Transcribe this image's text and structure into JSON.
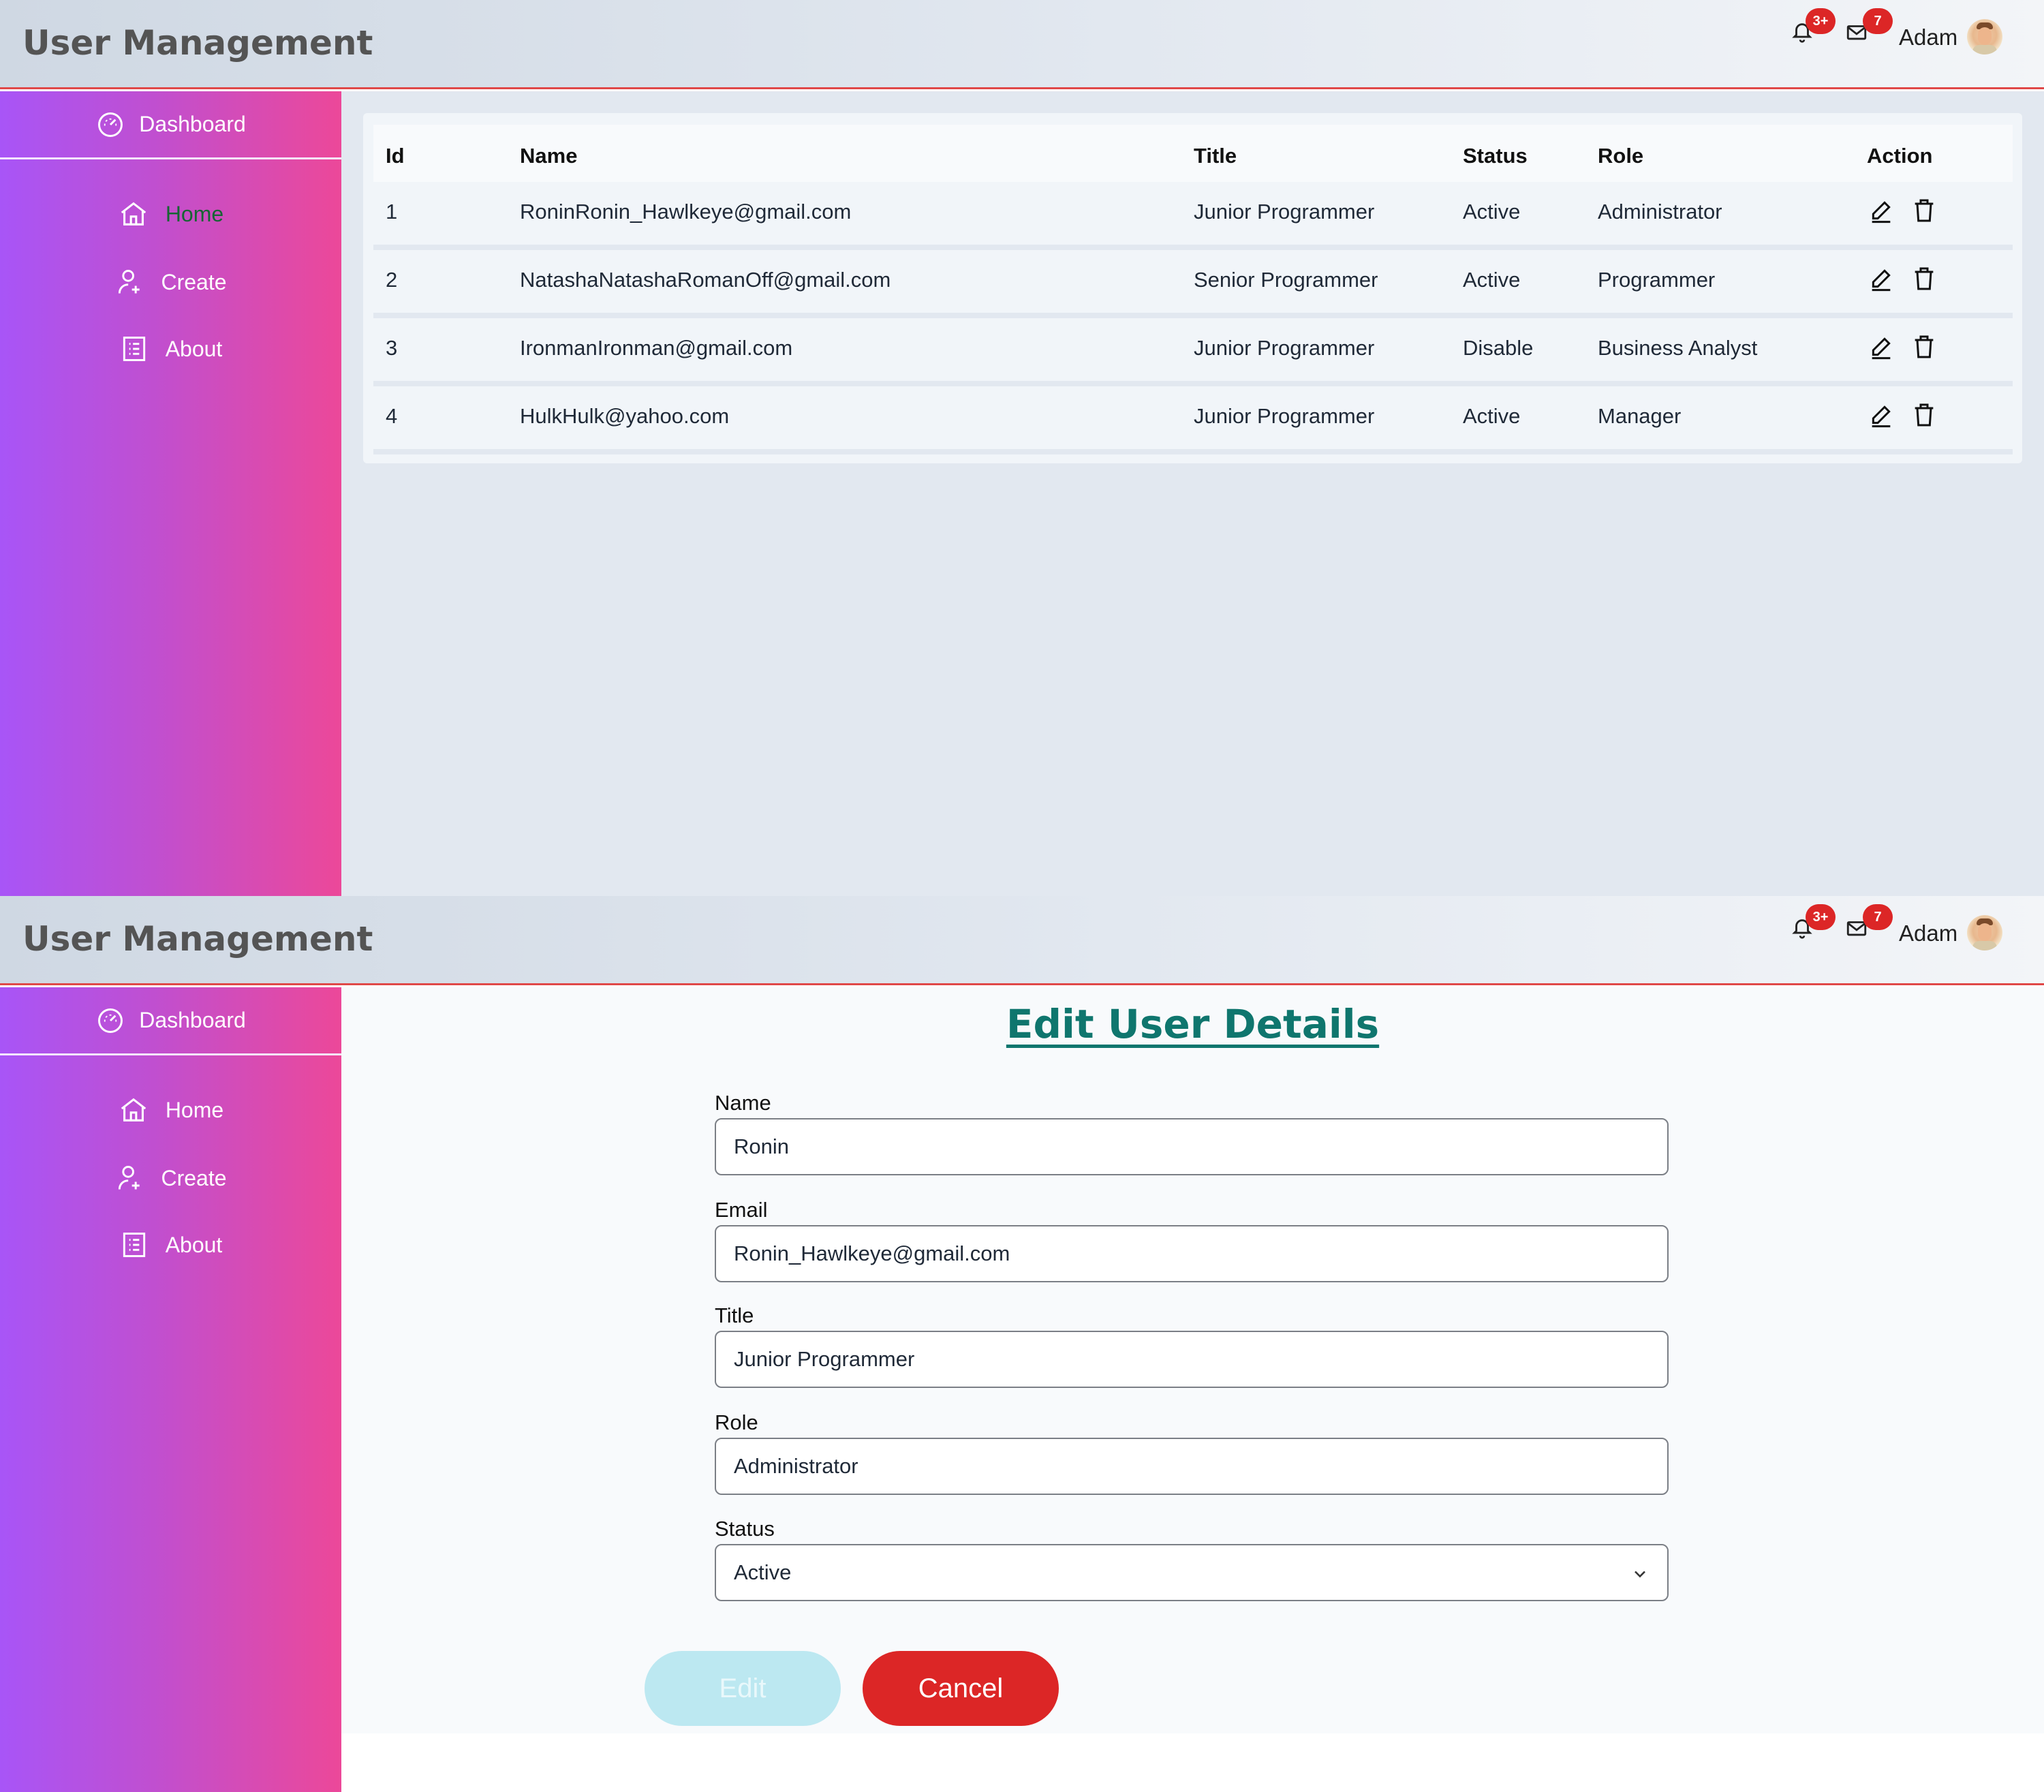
{
  "header": {
    "title": "User Management",
    "notification_badge": "3+",
    "mail_badge": "7",
    "user_name": "Adam"
  },
  "sidebar": {
    "dashboard_label": "Dashboard",
    "items": [
      {
        "label": "Home",
        "icon": "home-icon"
      },
      {
        "label": "Create",
        "icon": "user-add-icon"
      },
      {
        "label": "About",
        "icon": "list-icon"
      }
    ]
  },
  "table": {
    "columns": [
      "Id",
      "Name",
      "Title",
      "Status",
      "Role",
      "Action"
    ],
    "rows": [
      {
        "id": "1",
        "name": "RoninRonin_Hawlkeye@gmail.com",
        "title": "Junior Programmer",
        "status": "Active",
        "role": "Administrator"
      },
      {
        "id": "2",
        "name": "NatashaNatashaRomanOff@gmail.com",
        "title": "Senior Programmer",
        "status": "Active",
        "role": "Programmer"
      },
      {
        "id": "3",
        "name": "IronmanIronman@gmail.com",
        "title": "Junior Programmer",
        "status": "Disable",
        "role": "Business Analyst"
      },
      {
        "id": "4",
        "name": "HulkHulk@yahoo.com",
        "title": "Junior Programmer",
        "status": "Active",
        "role": "Manager"
      }
    ]
  },
  "edit_form": {
    "title": "Edit User Details",
    "fields": {
      "name": {
        "label": "Name",
        "value": "Ronin"
      },
      "email": {
        "label": "Email",
        "value": "Ronin_Hawlkeye@gmail.com"
      },
      "title": {
        "label": "Title",
        "value": "Junior Programmer"
      },
      "role": {
        "label": "Role",
        "value": "Administrator"
      },
      "status": {
        "label": "Status",
        "value": "Active"
      }
    },
    "edit_button": "Edit",
    "cancel_button": "Cancel"
  },
  "colors": {
    "accent_red": "#dc2626",
    "sidebar_start": "#a855f7",
    "sidebar_end": "#ec4899",
    "form_title": "#0f766e",
    "active_nav": "#166534"
  }
}
